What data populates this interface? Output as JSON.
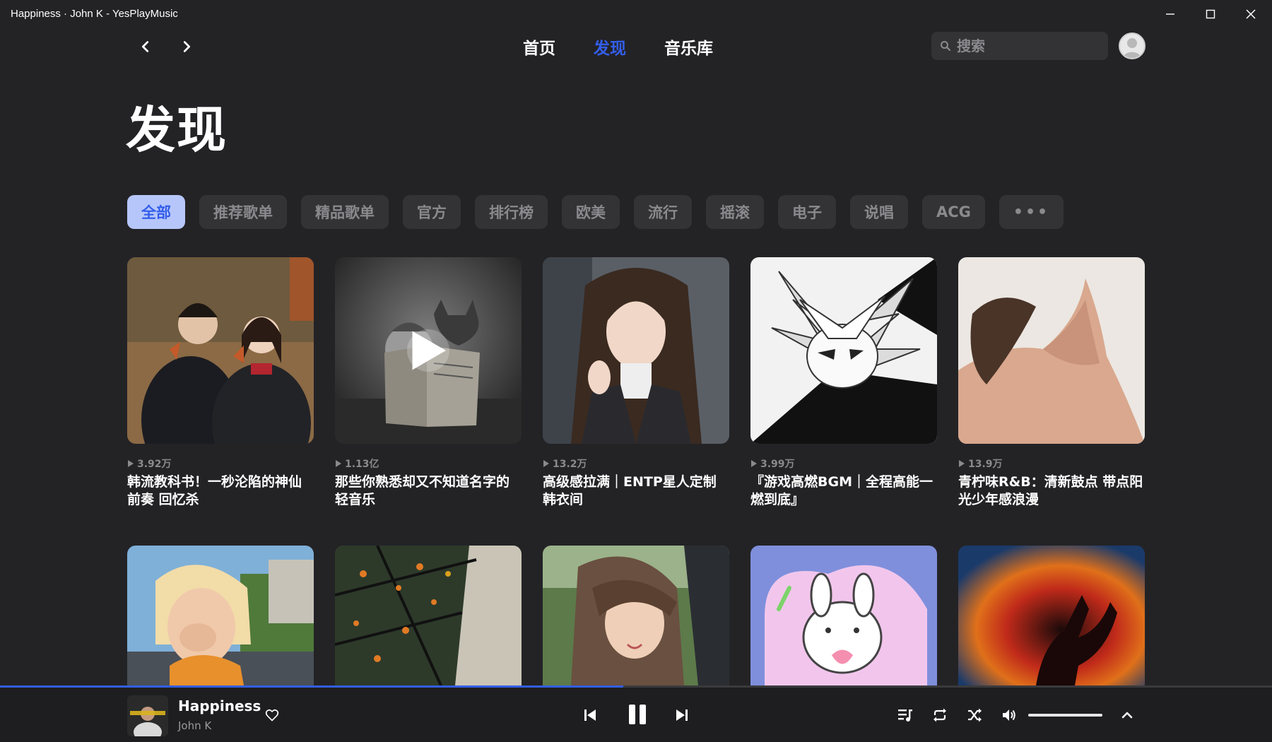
{
  "window": {
    "title": "Happiness · John K - YesPlayMusic"
  },
  "nav": {
    "links": [
      {
        "label": "首页",
        "active": false
      },
      {
        "label": "发现",
        "active": true
      },
      {
        "label": "音乐库",
        "active": false
      }
    ],
    "search_placeholder": "搜索"
  },
  "page": {
    "title": "发现"
  },
  "categories": [
    "全部",
    "推荐歌单",
    "精品歌单",
    "官方",
    "排行榜",
    "欧美",
    "流行",
    "摇滚",
    "电子",
    "说唱",
    "ACG",
    "•••"
  ],
  "playlists": [
    {
      "plays": "3.92万",
      "title": "韩流教科书！一秒沦陷的神仙前奏 回忆杀"
    },
    {
      "plays": "1.13亿",
      "title": "那些你熟悉却又不知道名字的轻音乐"
    },
    {
      "plays": "13.2万",
      "title": "高级感拉满｜ENTP星人定制韩衣间"
    },
    {
      "plays": "3.99万",
      "title": "『游戏高燃BGM｜全程高能一燃到底』"
    },
    {
      "plays": "13.9万",
      "title": "青柠味R&B：清新鼓点 带点阳光少年感浪漫"
    }
  ],
  "player": {
    "song": "Happiness",
    "artist": "John K",
    "progress": 0.49
  },
  "colors": {
    "accent": "#335eea",
    "background": "#232326",
    "chip": "#333336"
  }
}
